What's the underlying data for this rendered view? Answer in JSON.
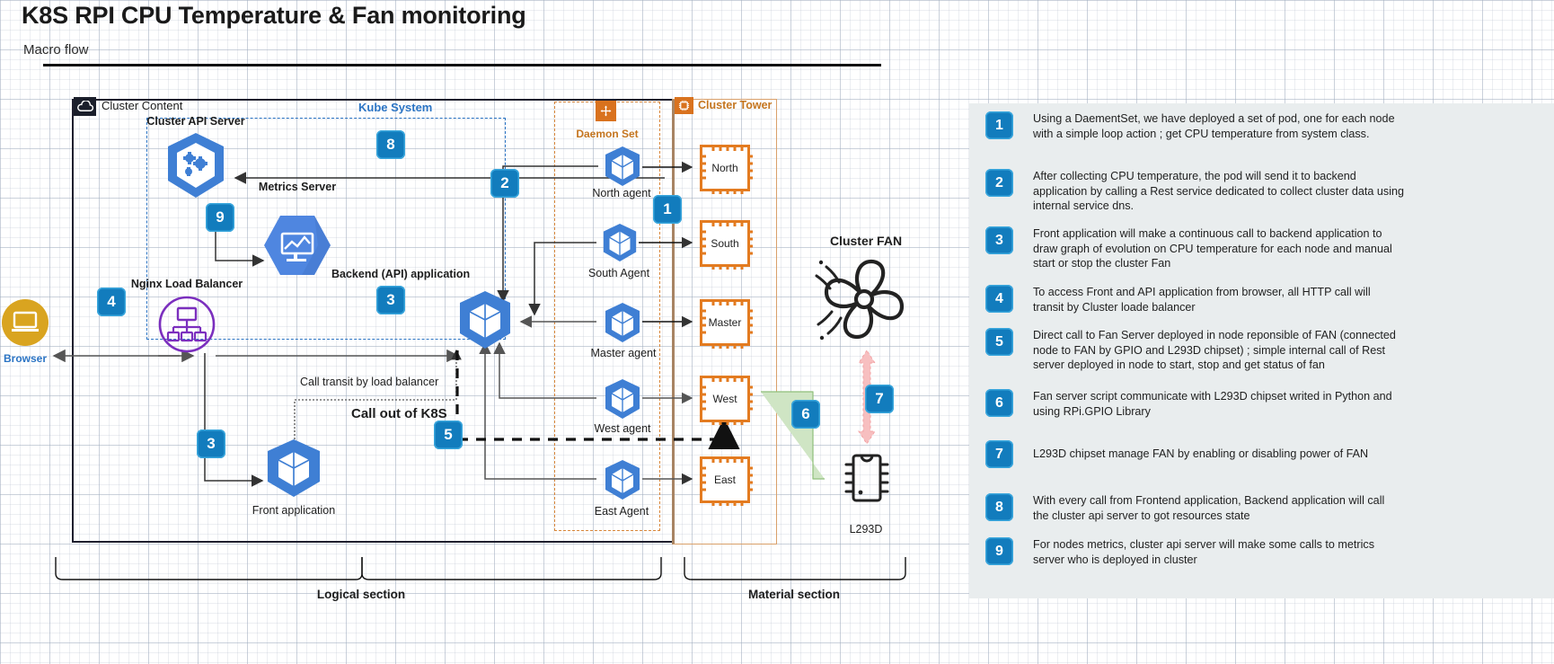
{
  "header": {
    "title": "K8S RPI CPU Temperature & Fan monitoring",
    "subtitle": "Macro flow"
  },
  "diagram": {
    "containers": {
      "cluster_content": "Cluster Content",
      "kube_system": "Kube System",
      "daemon_set": "Daemon Set",
      "cluster_tower": "Cluster Tower"
    },
    "nodes": {
      "browser": "Browser",
      "cluster_api_server": "Cluster API Server",
      "metrics_server": "Metrics Server",
      "nginx_load_balancer": "Nginx Load Balancer",
      "backend_api_application": "Backend (API) application",
      "front_application": "Front application",
      "cluster_fan": "Cluster FAN",
      "l293d": "L293D"
    },
    "agents": [
      "North agent",
      "South Agent",
      "Master agent",
      "West agent",
      "East Agent"
    ],
    "tower_nodes": [
      "North",
      "South",
      "Master",
      "West",
      "East"
    ],
    "annotations": {
      "call_transit": "Call transit by load balancer",
      "call_out_of_k8s": "Call out of K8S",
      "logical_section": "Logical section",
      "material_section": "Material section"
    },
    "badges": {
      "b1": "1",
      "b2": "2",
      "b3_backend": "3",
      "b3_front": "3",
      "b4": "4",
      "b5": "5",
      "b6": "6",
      "b7": "7",
      "b8": "8",
      "b9": "9"
    },
    "icon_names": {
      "cloud": "cloud-icon",
      "daemonset": "daemonset-icon",
      "chipset": "chipset-icon",
      "fan": "fan-icon",
      "browser": "browser-icon",
      "loadbalancer": "load-balancer-icon",
      "pod": "kubernetes-pod-icon",
      "apiserver": "kubernetes-api-server-icon",
      "metrics": "metrics-server-icon"
    },
    "colors": {
      "badge_blue": "#127cbd",
      "k8s_blue": "#3f7fd4",
      "orange": "#e37b20",
      "purple": "#7b2fbe",
      "browser_gold": "#d9a420",
      "legend_bg": "#e9edee",
      "green_arrow": "#cfe5c4",
      "pink_arrow": "#f7bfc0"
    }
  },
  "legend": {
    "items": [
      {
        "num": "1",
        "text": "Using a DaementSet, we have deployed a set of pod, one for each node with a simple loop action ; get CPU temperature from system class."
      },
      {
        "num": "2",
        "text": "After collecting CPU temperature, the pod will send it to backend application by calling a Rest service dedicated to collect cluster data using internal service dns."
      },
      {
        "num": "3",
        "text": "Front application will make a continuous call to backend application to draw graph of evolution on CPU temperature for each node and manual start or stop the cluster Fan"
      },
      {
        "num": "4",
        "text": "To access Front and API application from browser, all HTTP call will transit by Cluster loade balancer"
      },
      {
        "num": "5",
        "text": "Direct call to Fan Server deployed in node reponsible of FAN (connected node to FAN by GPIO and L293D chipset) ; simple internal call of Rest server deployed in node to start, stop and get status of fan"
      },
      {
        "num": "6",
        "text": "Fan server script communicate with L293D chipset writed in Python and using RPi.GPIO Library"
      },
      {
        "num": "7",
        "text": "L293D chipset manage FAN by enabling or disabling power of FAN"
      },
      {
        "num": "8",
        "text": "With every call from Frontend application, Backend application will call the cluster api server to got resources state"
      },
      {
        "num": "9",
        "text": "For nodes metrics, cluster api server will make some calls to metrics server who is deployed in cluster"
      }
    ]
  }
}
